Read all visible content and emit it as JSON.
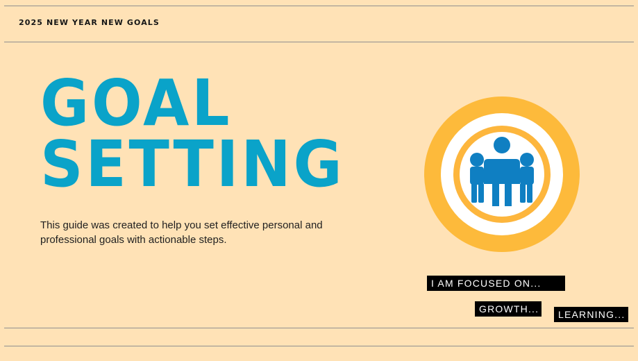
{
  "header": {
    "label": "2025 NEW YEAR NEW GOALS"
  },
  "hero": {
    "title_line_1": "GOAL",
    "title_line_2": "SETTING",
    "description": "This guide was created to help you set effective personal and professional goals with actionable steps."
  },
  "emblem": {
    "icon": "team-people-icon",
    "colors": {
      "outer_ring": "#fdba3b",
      "inner_ring": "#fdb63d",
      "people": "#0f7fc2",
      "background": "#ffffff"
    }
  },
  "tags": {
    "focused": "I AM FOCUSED ON...",
    "growth": "GROWTH...",
    "learning": "LEARNING..."
  },
  "colors": {
    "background": "#ffe2b6",
    "title": "#0aa3c9",
    "text": "#1f1f1f",
    "tag_background": "#000000",
    "tag_text": "#ffffff"
  }
}
